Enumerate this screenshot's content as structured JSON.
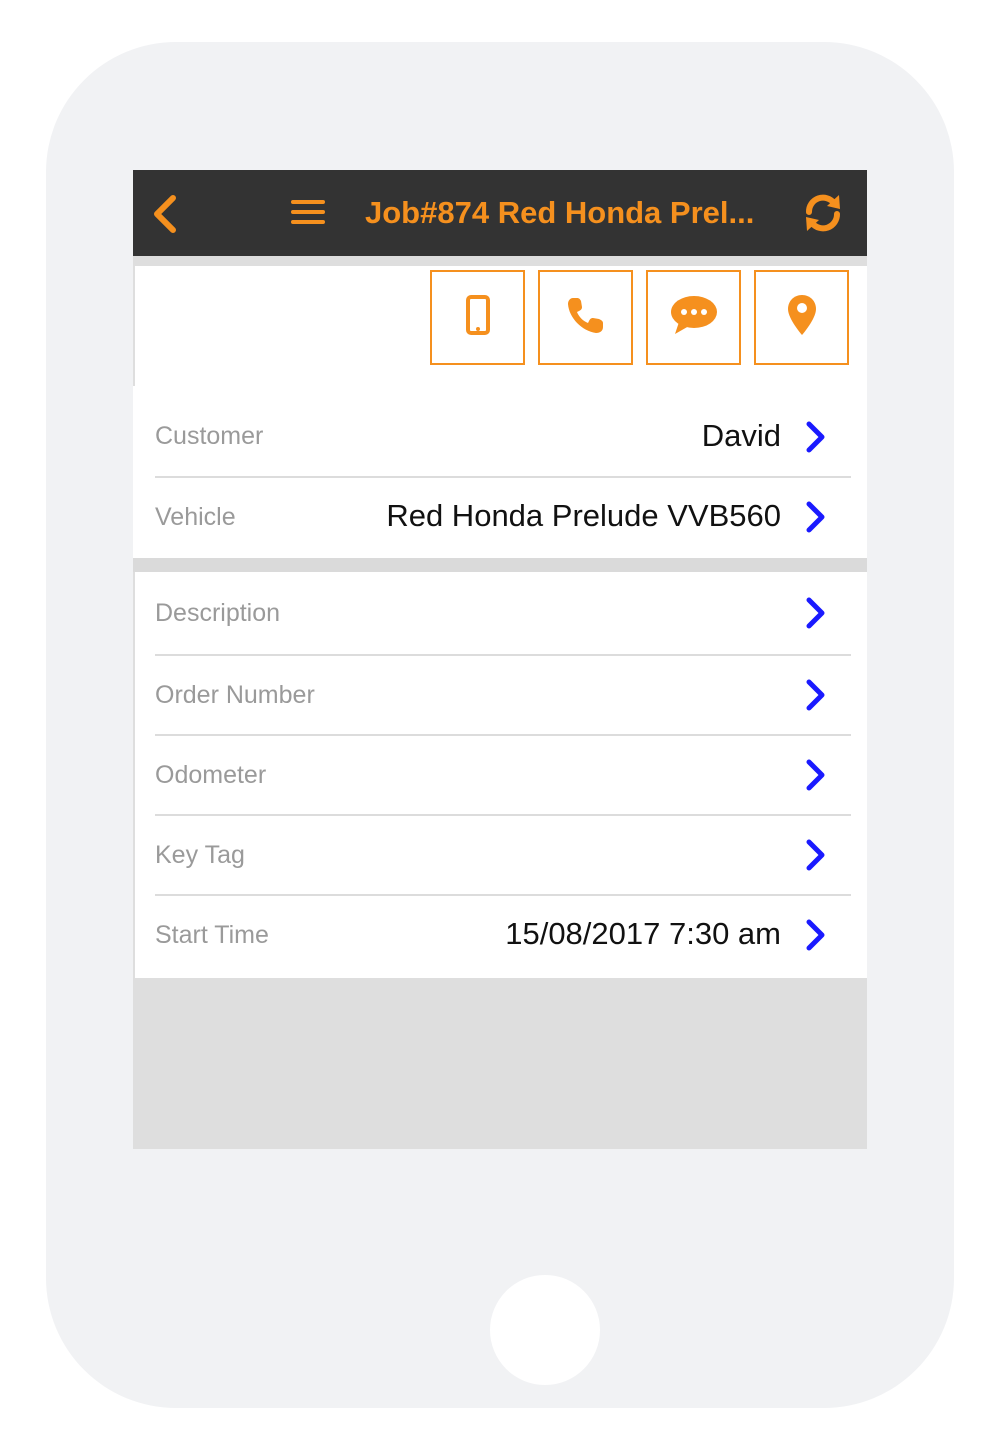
{
  "header": {
    "title": "Job#874 Red Honda Prel...",
    "back_icon": "chevron-left-icon",
    "menu_icon": "hamburger-menu-icon",
    "refresh_icon": "refresh-icon",
    "accent_color": "#f5901e",
    "bar_color": "#333333"
  },
  "actions": [
    {
      "icon": "mobile-phone-icon"
    },
    {
      "icon": "phone-icon"
    },
    {
      "icon": "chat-bubble-icon"
    },
    {
      "icon": "map-pin-icon"
    }
  ],
  "details": {
    "customer": {
      "label": "Customer",
      "value": "David"
    },
    "vehicle": {
      "label": "Vehicle",
      "value": "Red Honda Prelude VVB560"
    }
  },
  "fields": {
    "description": {
      "label": "Description",
      "value": ""
    },
    "order_number": {
      "label": "Order Number",
      "value": ""
    },
    "odometer": {
      "label": "Odometer",
      "value": ""
    },
    "key_tag": {
      "label": "Key Tag",
      "value": ""
    },
    "start_time": {
      "label": "Start Time",
      "value": "15/08/2017 7:30 am"
    }
  },
  "chevron_color": "#1a1aff"
}
